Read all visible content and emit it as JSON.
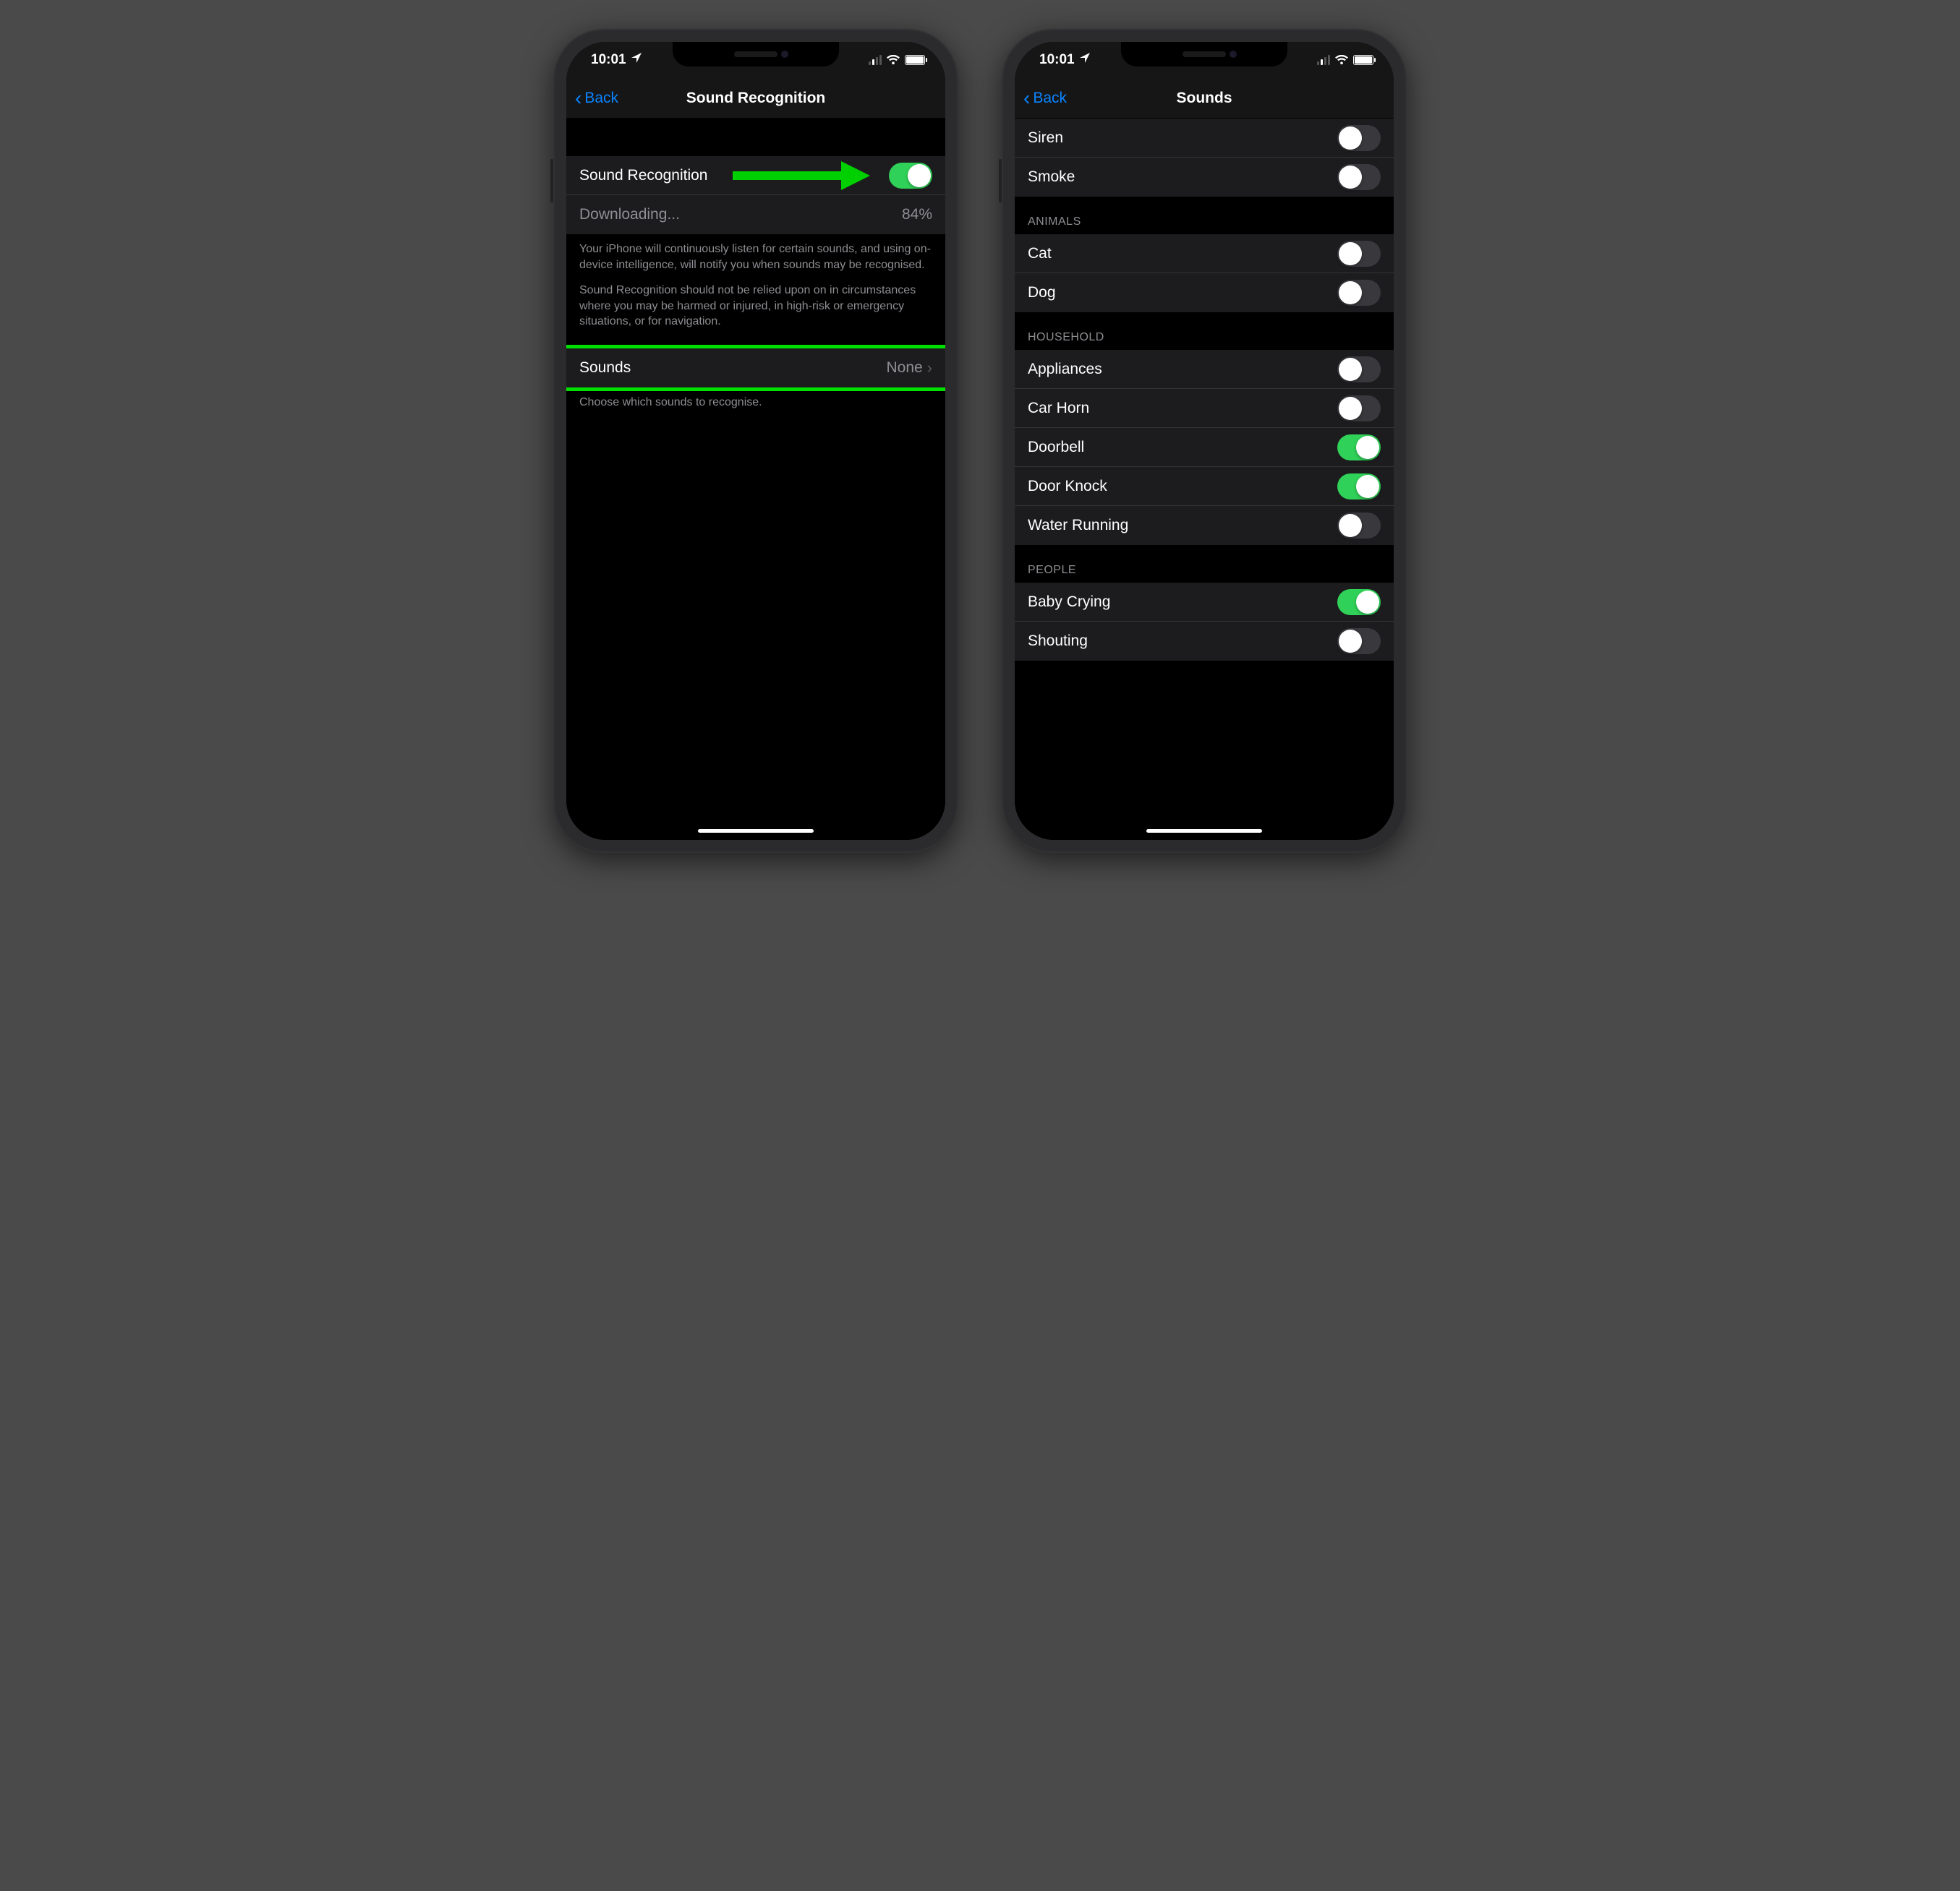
{
  "status": {
    "time": "10:01",
    "location_icon": "◤"
  },
  "left": {
    "back_label": "Back",
    "title": "Sound Recognition",
    "main_toggle": {
      "label": "Sound Recognition",
      "on": true
    },
    "download": {
      "label": "Downloading...",
      "pct": "84%"
    },
    "footer1": "Your iPhone will continuously listen for certain sounds, and using on-device intelligence, will notify you when sounds may be recognised.",
    "footer2": "Sound Recognition should not be relied upon on in circumstances where you may be harmed or injured, in high-risk or emergency situations, or for navigation.",
    "sounds_row": {
      "label": "Sounds",
      "value": "None"
    },
    "footer3": "Choose which sounds to recognise."
  },
  "right": {
    "back_label": "Back",
    "title": "Sounds",
    "top_rows": [
      {
        "label": "Siren",
        "on": false
      },
      {
        "label": "Smoke",
        "on": false
      }
    ],
    "animals_header": "ANIMALS",
    "animals_rows": [
      {
        "label": "Cat",
        "on": false
      },
      {
        "label": "Dog",
        "on": false
      }
    ],
    "household_header": "HOUSEHOLD",
    "household_rows": [
      {
        "label": "Appliances",
        "on": false
      },
      {
        "label": "Car Horn",
        "on": false
      },
      {
        "label": "Doorbell",
        "on": true
      },
      {
        "label": "Door Knock",
        "on": true
      },
      {
        "label": "Water Running",
        "on": false
      }
    ],
    "people_header": "PEOPLE",
    "people_rows": [
      {
        "label": "Baby Crying",
        "on": true
      },
      {
        "label": "Shouting",
        "on": false
      }
    ]
  }
}
